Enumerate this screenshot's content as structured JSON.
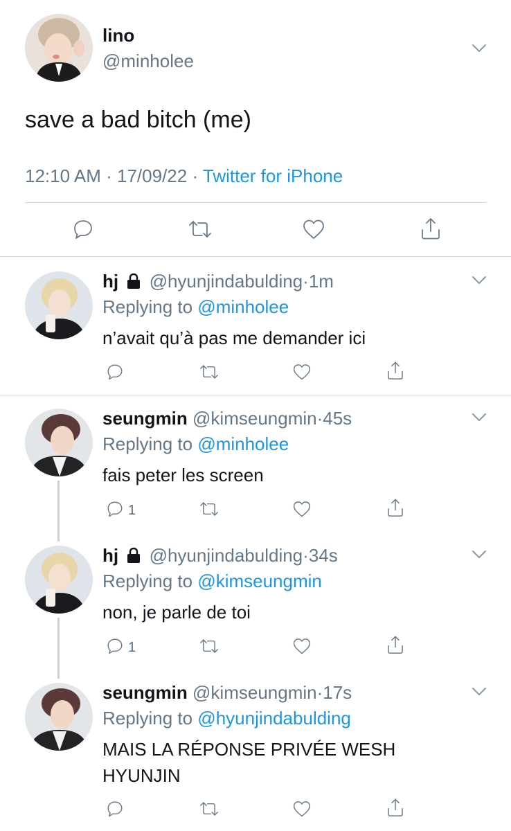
{
  "main_tweet": {
    "name": "lino",
    "handle": "@minholee",
    "text": "save a bad bitch (me)",
    "time": "12:10 AM",
    "date": "17/09/22",
    "sep": "·",
    "source": "Twitter for iPhone",
    "avatar_icon": "avatar-photo",
    "actions": [
      "reply-icon",
      "retweet-icon",
      "like-icon",
      "share-icon"
    ]
  },
  "replies": [
    {
      "name": "hj",
      "handle": "@hyunjindabulding",
      "time": "1m",
      "replying_prefix": "Replying to",
      "replying_to": "@minholee",
      "text": "n’avait qu’à pas me demander ici",
      "reply_count": "",
      "protected": true
    },
    {
      "name": "seungmin",
      "handle": "@kimseungmin",
      "time": "45s",
      "replying_prefix": "Replying to",
      "replying_to": "@minholee",
      "text": "fais peter les screen",
      "reply_count": "1",
      "protected": false
    },
    {
      "name": "hj",
      "handle": "@hyunjindabulding",
      "time": "34s",
      "replying_prefix": "Replying to",
      "replying_to": "@kimseungmin",
      "text": "non, je parle de toi",
      "reply_count": "1",
      "protected": true
    },
    {
      "name": "seungmin",
      "handle": "@kimseungmin",
      "time": "17s",
      "replying_prefix": "Replying to",
      "replying_to": "@hyunjindabulding",
      "text": "MAIS LA RÉPONSE PRIVÉE WESH HYUNJIN",
      "reply_count": "",
      "protected": false
    }
  ],
  "colors": {
    "link": "#1d95e0",
    "secondary_text": "#657786",
    "icon": "#6b7a88",
    "divider": "#d4d9de"
  }
}
